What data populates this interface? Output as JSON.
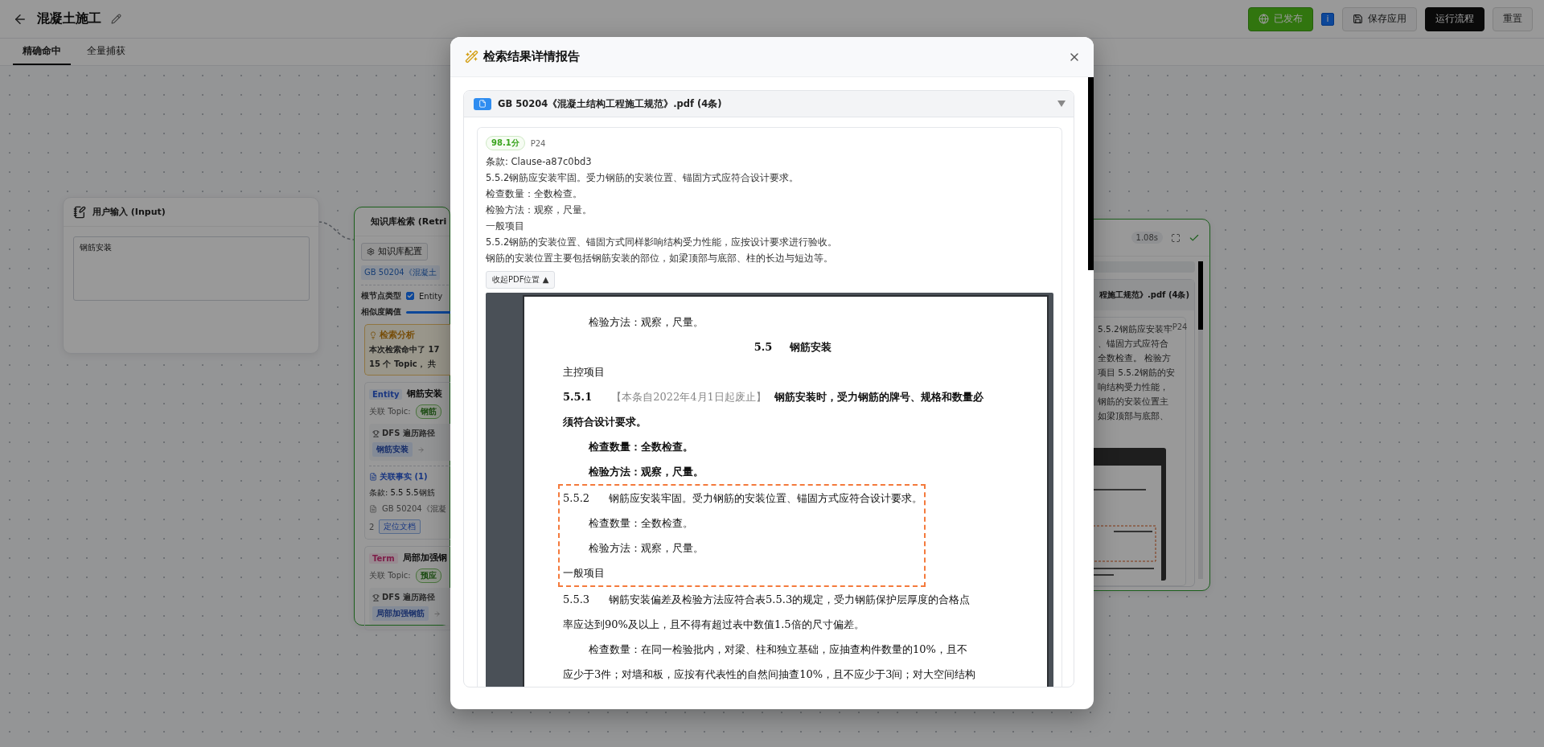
{
  "topbar": {
    "title": "混凝土施工",
    "buttons": [
      {
        "kind": "published",
        "label": "已发布"
      },
      {
        "kind": "info",
        "label": "i"
      },
      {
        "kind": "save",
        "label": "保存应用"
      },
      {
        "kind": "run",
        "label": "运行流程"
      },
      {
        "kind": "reset",
        "label": "重置"
      }
    ]
  },
  "tabs": [
    {
      "label": "精确命中",
      "selected": true
    },
    {
      "label": "全量捕获",
      "selected": false
    }
  ],
  "input_node": {
    "title": "用户输入 (Input)",
    "value": "钢筋安装"
  },
  "retrieval_node": {
    "title": "知识库检索 (Retri",
    "config_button": "知识库配置",
    "source_tag": "GB 50204《混凝土",
    "root_type_label": "根节点类型",
    "root_type": {
      "label": "Entity",
      "checked": true
    },
    "threshold_label": "相似度阈值",
    "analysis": {
      "title": "检索分析",
      "lines": [
        "本次检索命中了 17",
        "15 个 Topic， 共"
      ]
    },
    "results": [
      {
        "type": "Entity",
        "name": "钢筋安装",
        "topic_label": "关联 Topic:",
        "topic": "钢筋",
        "dfs_label": "DFS 遍历路径",
        "path": [
          "钢筋安装"
        ],
        "facts_title": "关联事实 (1)",
        "fact": "条款: 5.5 5.5钢筋",
        "source": "GB 50204《混凝",
        "page": "2",
        "locate_button": "定位文档"
      },
      {
        "type": "Term",
        "name": "局部加强钢",
        "topic_label": "关联 Topic:",
        "topic": "预应",
        "dfs_label": "DFS 遍历路径",
        "path": [
          "局部加强钢筋"
        ]
      }
    ]
  },
  "output_node": {
    "time": "1.08s",
    "doc_title": "程施工规范》.pdf (4条)",
    "page": "P24",
    "lines": [
      "5.5.2钢筋应安装牢",
      "、锚固方式应符合",
      "全数检查。 检验方",
      "项目 5.5.2钢筋的安",
      "响结构受力性能，",
      "钢筋的安装位置主",
      "如梁顶部与底部、"
    ]
  },
  "modal": {
    "title": "检索结果详情报告",
    "group": {
      "title": "GB 50204《混凝土结构工程施工规范》.pdf (4条)",
      "expanded": true,
      "result": {
        "score": "98.1分",
        "page": "P24",
        "lines": [
          "条款: Clause-a87c0bd3",
          "5.5.2钢筋应安装牢固。受力钢筋的安装位置、锚固方式应符合设计要求。",
          "检查数量：全数检查。",
          "检验方法：观察，尺量。",
          "一般项目",
          "5.5.2钢筋的安装位置、锚固方式同样影响结构受力性能，应按设计要求进行验收。",
          "钢筋的安装位置主要包括钢筋安装的部位，如梁顶部与底部、柱的长边与短边等。"
        ],
        "toggle_button": "收起PDF位置 ▲",
        "pdf_lines": [
          {
            "kind": "indent",
            "bold": false,
            "highlighted": false,
            "text": "检验方法：观察，尺量。"
          },
          {
            "kind": "heading",
            "bold": true,
            "highlighted": false,
            "number": "5.5",
            "text": "钢筋安装"
          },
          {
            "kind": "plain",
            "bold": false,
            "highlighted": false,
            "text": "主控项目"
          },
          {
            "kind": "clause",
            "bold": true,
            "highlighted": false,
            "number": "5.5.1",
            "note": "【本条自2022年4月1日起废止】",
            "text": "钢筋安装时，受力钢筋的牌号、规格和数量必"
          },
          {
            "kind": "plain",
            "bold": true,
            "highlighted": false,
            "text": "须符合设计要求。"
          },
          {
            "kind": "indent",
            "bold": true,
            "highlighted": false,
            "text": "检查数量：全数检查。"
          },
          {
            "kind": "indent",
            "bold": true,
            "highlighted": false,
            "text": "检验方法：观察，尺量。"
          },
          {
            "kind": "clause",
            "bold": false,
            "highlighted": true,
            "number": "5.5.2",
            "text": "钢筋应安装牢固。受力钢筋的安装位置、锚固方式应符合设计要求。"
          },
          {
            "kind": "indent",
            "bold": false,
            "highlighted": true,
            "text": "检查数量：全数检查。"
          },
          {
            "kind": "indent",
            "bold": false,
            "highlighted": true,
            "text": "检验方法：观察，尺量。"
          },
          {
            "kind": "plain",
            "bold": false,
            "highlighted": true,
            "text": "一般项目"
          },
          {
            "kind": "clause",
            "bold": false,
            "highlighted": false,
            "number": "5.5.3",
            "text": "钢筋安装偏差及检验方法应符合表5.5.3的规定，受力钢筋保护层厚度的合格点"
          },
          {
            "kind": "plain",
            "bold": false,
            "highlighted": false,
            "text": "率应达到90%及以上，且不得有超过表中数值1.5倍的尺寸偏差。"
          },
          {
            "kind": "indent",
            "bold": false,
            "highlighted": false,
            "text": "检查数量：在同一检验批内，对梁、柱和独立基础，应抽查构件数量的10%，且不"
          },
          {
            "kind": "plain",
            "bold": false,
            "highlighted": false,
            "text": "应少于3件；对墙和板，应按有代表性的自然间抽查10%，且不应少于3间；对大空间结构"
          }
        ]
      }
    }
  }
}
